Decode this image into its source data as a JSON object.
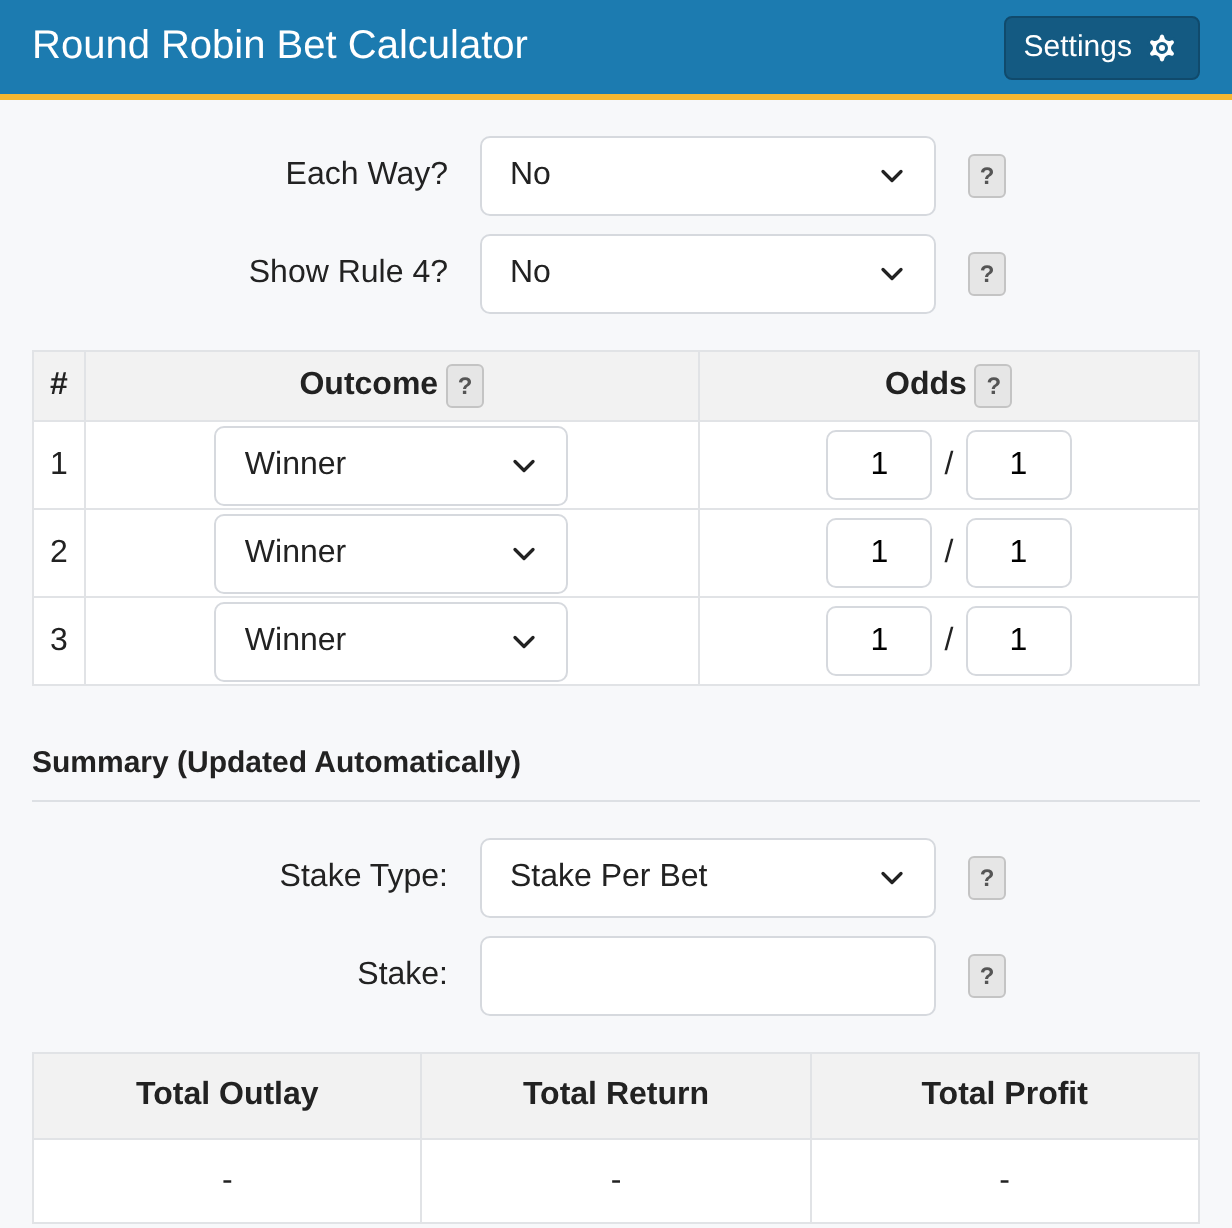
{
  "header": {
    "title": "Round Robin Bet Calculator",
    "settings_button": "Settings"
  },
  "options": [
    {
      "label": "Each Way?",
      "value": "No",
      "help": "?"
    },
    {
      "label": "Show Rule 4?",
      "value": "No",
      "help": "?"
    }
  ],
  "selections": {
    "columns": [
      {
        "label": "#"
      },
      {
        "label": "Outcome",
        "help": "?"
      },
      {
        "label": "Odds",
        "help": "?"
      }
    ],
    "rows": [
      {
        "number": "1",
        "outcome": "Winner",
        "odds_num": "1",
        "separator": "/",
        "odds_den": "1"
      },
      {
        "number": "2",
        "outcome": "Winner",
        "odds_num": "1",
        "separator": "/",
        "odds_den": "1"
      },
      {
        "number": "3",
        "outcome": "Winner",
        "odds_num": "1",
        "separator": "/",
        "odds_den": "1"
      }
    ]
  },
  "summary": {
    "heading": "Summary (Updated Automatically)",
    "fields": [
      {
        "kind": "select",
        "label": "Stake Type:",
        "value": "Stake Per Bet",
        "help": "?"
      },
      {
        "kind": "input",
        "label": "Stake:",
        "help": "?"
      }
    ],
    "totals": {
      "columns": [
        "Total Outlay",
        "Total Return",
        "Total Profit"
      ],
      "values": [
        "-",
        "-",
        "-"
      ]
    }
  }
}
